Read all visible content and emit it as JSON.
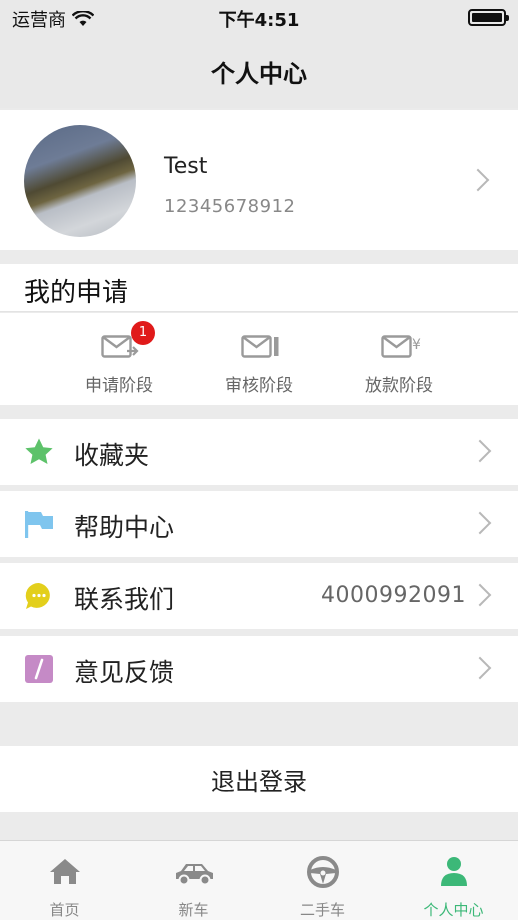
{
  "status_bar": {
    "carrier": "运营商",
    "time": "下午4:51"
  },
  "nav": {
    "title": "个人中心"
  },
  "profile": {
    "name": "Test",
    "phone": "12345678912"
  },
  "my_applications": {
    "title": "我的申请",
    "stages": [
      {
        "label": "申请阶段",
        "badge": "1",
        "icon": "mail-arrow-icon"
      },
      {
        "label": "审核阶段",
        "icon": "mail-edit-icon"
      },
      {
        "label": "放款阶段",
        "icon": "mail-yen-icon"
      }
    ]
  },
  "menu": [
    {
      "label": "收藏夹",
      "icon": "star-icon",
      "color": "#5dc26a"
    },
    {
      "label": "帮助中心",
      "icon": "flag-icon",
      "color": "#7fc5ee"
    },
    {
      "label": "联系我们",
      "value": "4000992091",
      "icon": "chat-bubble-icon",
      "color": "#e3cf1c"
    },
    {
      "label": "意见反馈",
      "icon": "pencil-icon",
      "color": "#c58ac6"
    }
  ],
  "logout": {
    "label": "退出登录"
  },
  "tab_bar": {
    "active_color": "#3cb878",
    "tabs": [
      {
        "label": "首页",
        "icon": "home-icon"
      },
      {
        "label": "新车",
        "icon": "car-icon"
      },
      {
        "label": "二手车",
        "icon": "steering-wheel-icon"
      },
      {
        "label": "个人中心",
        "icon": "person-icon",
        "active": true
      }
    ]
  }
}
